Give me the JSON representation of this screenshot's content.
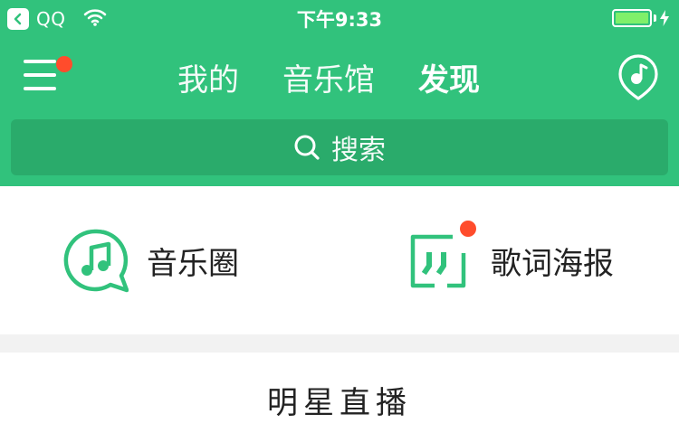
{
  "status_bar": {
    "back_app_label": "QQ",
    "time": "下午9:33",
    "battery_level": 1.0
  },
  "nav": {
    "tabs": [
      {
        "label": "我的",
        "active": false
      },
      {
        "label": "音乐馆",
        "active": false
      },
      {
        "label": "发现",
        "active": true
      }
    ],
    "menu_badge": true
  },
  "search": {
    "label": "搜索"
  },
  "features": [
    {
      "label": "音乐圈",
      "icon": "music-circle-icon",
      "badge": false
    },
    {
      "label": "歌词海报",
      "icon": "lyrics-poster-icon",
      "badge": true
    }
  ],
  "section": {
    "title": "明星直播"
  },
  "colors": {
    "brand": "#31c27c",
    "search_bg": "#2aab6b",
    "badge": "#ff4c2c",
    "battery": "#7ff06a"
  }
}
